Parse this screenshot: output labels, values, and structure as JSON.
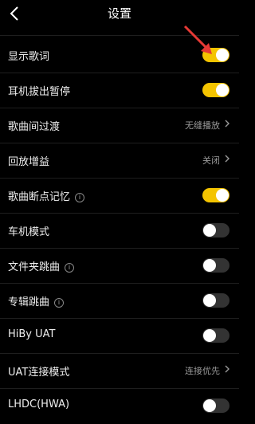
{
  "header": {
    "title": "设置"
  },
  "accent": "#f4c400",
  "icons": {
    "back": "chevron-left-icon",
    "chevron": "chevron-right-icon",
    "info": "info-icon"
  },
  "settings": [
    {
      "label": "显示歌词",
      "control": "toggle",
      "on": true
    },
    {
      "label": "耳机拔出暂停",
      "control": "toggle",
      "on": true
    },
    {
      "label": "歌曲间过渡",
      "control": "link",
      "value": "无缝播放"
    },
    {
      "label": "回放增益",
      "control": "link",
      "value": "关闭"
    },
    {
      "label": "歌曲断点记忆",
      "control": "toggle",
      "on": true,
      "info": true
    },
    {
      "label": "车机模式",
      "control": "toggle",
      "on": false
    },
    {
      "label": "文件夹跳曲",
      "control": "toggle",
      "on": false,
      "info": true
    },
    {
      "label": "专辑跳曲",
      "control": "toggle",
      "on": false,
      "info": true
    },
    {
      "label": "HiBy UAT",
      "control": "toggle",
      "on": false
    },
    {
      "label": "UAT连接模式",
      "control": "link",
      "value": "连接优先"
    },
    {
      "label": "LHDC(HWA)",
      "control": "toggle",
      "on": false
    }
  ]
}
